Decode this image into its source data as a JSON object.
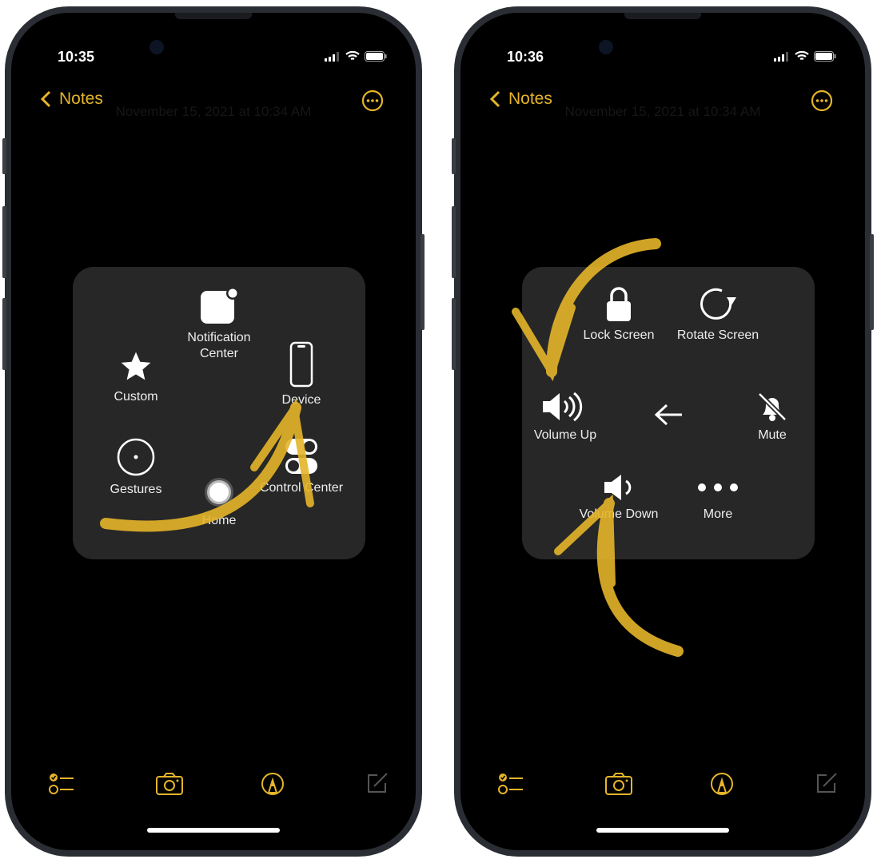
{
  "accent": "#e5b52a",
  "phones": [
    {
      "time": "10:35",
      "nav": {
        "back_label": "Notes",
        "date": "November 15, 2021 at 10:34 AM"
      },
      "menu": {
        "items": [
          {
            "label": "Notification Center",
            "icon": "notification-center-icon"
          },
          {
            "label": "Custom",
            "icon": "star-icon"
          },
          {
            "label": "Device",
            "icon": "iphone-icon"
          },
          {
            "label": "Gestures",
            "icon": "gestures-icon"
          },
          {
            "label": "Home",
            "icon": "home-button-icon"
          },
          {
            "label": "Control Center",
            "icon": "control-center-icon"
          }
        ]
      }
    },
    {
      "time": "10:36",
      "nav": {
        "back_label": "Notes",
        "date": "November 15, 2021 at 10:34 AM"
      },
      "menu": {
        "items": [
          {
            "label": "Lock Screen",
            "icon": "lock-icon"
          },
          {
            "label": "Rotate Screen",
            "icon": "rotate-icon"
          },
          {
            "label": "Volume Up",
            "icon": "volume-up-icon"
          },
          {
            "label": "Mute",
            "icon": "bell-slash-icon"
          },
          {
            "label": "Volume Down",
            "icon": "volume-down-icon"
          },
          {
            "label": "More",
            "icon": "ellipsis-icon"
          }
        ],
        "back_icon": "arrow-left-icon"
      }
    }
  ],
  "toolbar": [
    "checklist-icon",
    "camera-icon",
    "markup-icon",
    "compose-icon"
  ]
}
